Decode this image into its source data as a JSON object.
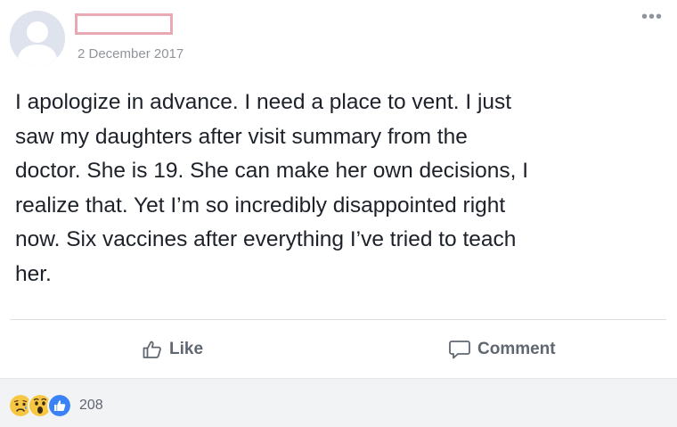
{
  "post": {
    "timestamp": "2 December 2017",
    "more_icon": "more-dots-icon",
    "lines": [
      "I apologize in advance. I need a place to vent. I just",
      "saw my daughters after visit summary from the",
      "doctor. She is 19. She can make her own decisions, I",
      "realize that. Yet I’m so incredibly disappointed right",
      "now. Six vaccines after everything I’ve tried to teach",
      "her."
    ]
  },
  "actions": {
    "like_label": "Like",
    "comment_label": "Comment"
  },
  "reactions": {
    "icons": [
      "sad-reaction-icon",
      "wow-reaction-icon",
      "like-reaction-icon"
    ],
    "count": "208"
  },
  "colors": {
    "text": "#1d2129",
    "muted": "#90949c",
    "action": "#606770",
    "like_blue": "#3b82f6",
    "reaction_yellow": "#f7c744",
    "redaction": "#e8a8b4",
    "footer_bg": "#f2f3f5"
  }
}
